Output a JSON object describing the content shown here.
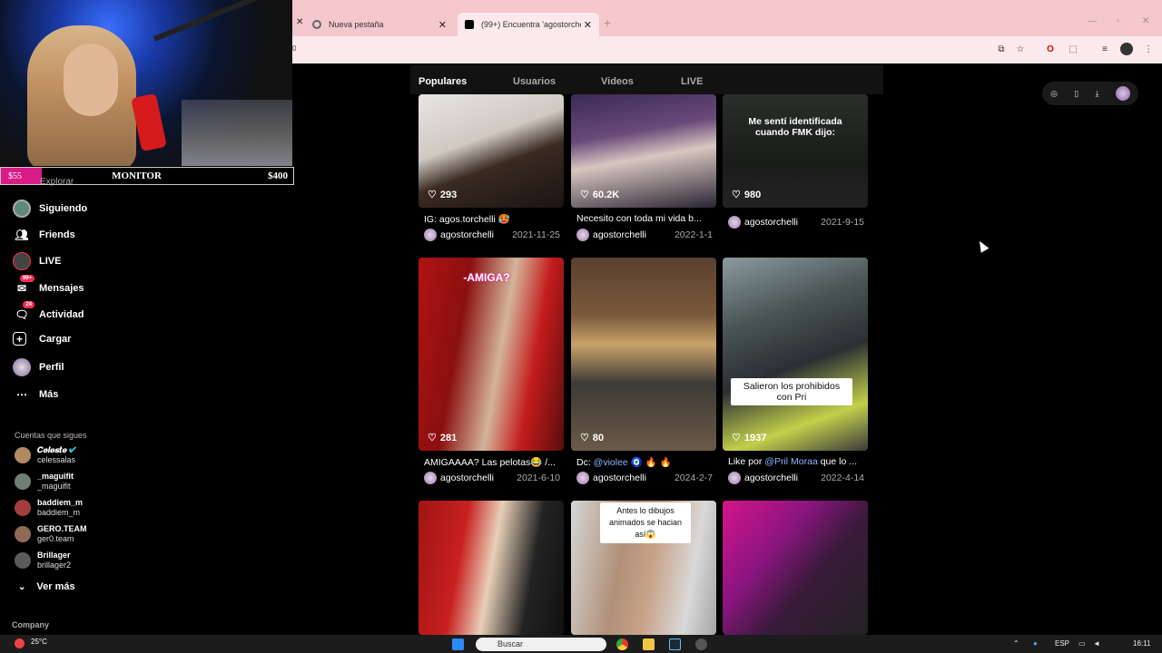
{
  "browser": {
    "tabs": [
      {
        "title": "Nueva pestaña",
        "active": false
      },
      {
        "title": "(99+) Encuentra 'agostorchelli' e",
        "active": true
      }
    ],
    "address_text": "0"
  },
  "stream_overlay": {
    "left_amount": "$55",
    "title": "MONITOR",
    "right_amount": "$400"
  },
  "sidebar": {
    "explorar": "Explorar",
    "items": [
      {
        "label": "Siguiendo",
        "icon": "following-avatar-icon"
      },
      {
        "label": "Friends",
        "icon": "friends-icon"
      },
      {
        "label": "LIVE",
        "icon": "live-icon"
      },
      {
        "label": "Mensajes",
        "icon": "messages-icon",
        "badge": "99+"
      },
      {
        "label": "Actividad",
        "icon": "activity-icon",
        "badge": "24"
      },
      {
        "label": "Cargar",
        "icon": "upload-icon"
      },
      {
        "label": "Perfil",
        "icon": "profile-avatar-icon"
      },
      {
        "label": "Más",
        "icon": "more-icon"
      }
    ],
    "following_title": "Cuentas que sigues",
    "following": [
      {
        "name": "𝑪𝒆𝒍𝒆𝒔𝒕𝒆",
        "handle": "celessalas",
        "verified": true
      },
      {
        "name": "_maguifit",
        "handle": "_maguifit"
      },
      {
        "name": "baddiem_m",
        "handle": "baddiem_m"
      },
      {
        "name": "GERO.TEAM",
        "handle": "ger0.team"
      },
      {
        "name": "Brillager",
        "handle": "brillager2"
      }
    ],
    "ver_mas": "Ver más",
    "company": "Company"
  },
  "search_tabs": [
    "Populares",
    "Usuarios",
    "Videos",
    "LIVE"
  ],
  "videos": [
    {
      "likes": "293",
      "caption": "IG: agos.torchelli 🥵",
      "author": "agostorchelli",
      "date": "2021-11-25"
    },
    {
      "likes": "60.2K",
      "caption": "Necesito con toda mi vida b...",
      "author": "agostorchelli",
      "date": "2022-1-1"
    },
    {
      "likes": "980",
      "caption": "",
      "author": "agostorchelli",
      "date": "2021-9-15",
      "overlay": "Me sentí identificada cuando FMK dijo:"
    },
    {
      "likes": "281",
      "caption": "AMIGAAAA? Las pelotas😂 /...",
      "author": "agostorchelli",
      "date": "2021-6-10",
      "overlay": "-AMIGA?"
    },
    {
      "likes": "80",
      "caption_prefix": "Dc: ",
      "mention": "@violee",
      "caption_suffix": " 🧿 🔥 🔥",
      "author": "agostorchelli",
      "date": "2024-2-7"
    },
    {
      "likes": "1937",
      "caption_prefix": "Like por ",
      "mention": "@Pril Moraa",
      "caption_suffix": " que lo ...",
      "author": "agostorchelli",
      "date": "2022-4-14",
      "overlay": "Salieron los prohibidos con Pri"
    },
    {
      "overlay": "Antes lo dibujos animados se hacian así😱"
    }
  ],
  "taskbar": {
    "weather": "25°C",
    "search_placeholder": "Buscar",
    "lang": "ESP",
    "time": "16:11"
  }
}
